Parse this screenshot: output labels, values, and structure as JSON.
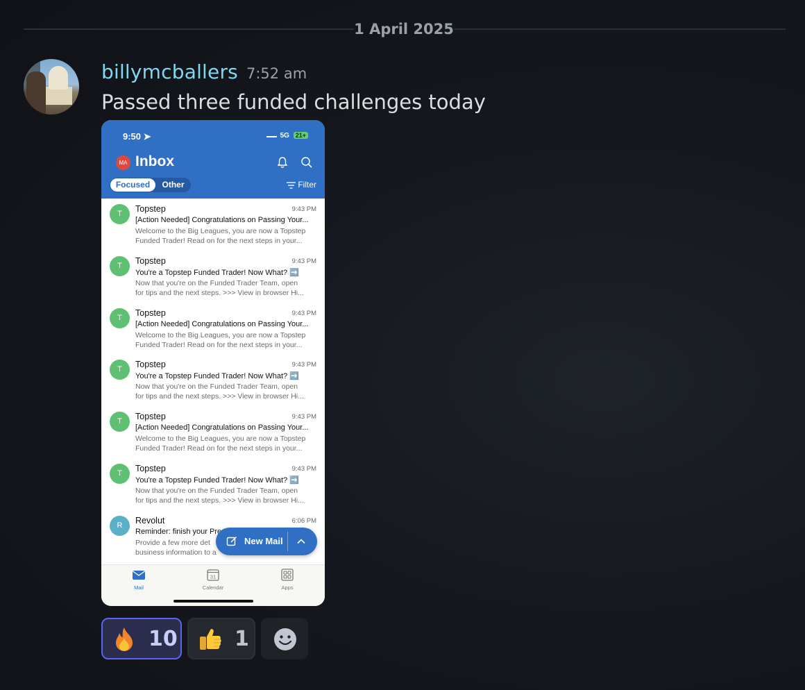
{
  "date_divider": "1 April 2025",
  "message": {
    "username": "billymcballers",
    "timestamp": "7:52 am",
    "text": "Passed three funded challenges today",
    "username_color": "#7fd8f0"
  },
  "screenshot": {
    "status_time": "9:50",
    "network": "5G",
    "battery": "21+",
    "account_initials": "MA",
    "title": "Inbox",
    "tabs": {
      "focused": "Focused",
      "other": "Other"
    },
    "filter_label": "Filter",
    "emails": [
      {
        "avatar": "T",
        "avatar_color": "#5fbf73",
        "sender": "Topstep",
        "time": "9:43 PM",
        "subject": "[Action Needed] Congratulations on Passing Your...",
        "preview1": "Welcome to the Big Leagues, you are now a Topstep",
        "preview2": "Funded Trader! Read on for the next steps in your..."
      },
      {
        "avatar": "T",
        "avatar_color": "#5fbf73",
        "sender": "Topstep",
        "time": "9:43 PM",
        "subject": "You're a Topstep Funded Trader! Now What? ➡️",
        "preview1": "Now that you're on the Funded Trader Team, open",
        "preview2": "for tips and the next steps. >>> View in browser Hi..."
      },
      {
        "avatar": "T",
        "avatar_color": "#5fbf73",
        "sender": "Topstep",
        "time": "9:43 PM",
        "subject": "[Action Needed] Congratulations on Passing Your...",
        "preview1": "Welcome to the Big Leagues, you are now a Topstep",
        "preview2": "Funded Trader! Read on for the next steps in your..."
      },
      {
        "avatar": "T",
        "avatar_color": "#5fbf73",
        "sender": "Topstep",
        "time": "9:43 PM",
        "subject": "You're a Topstep Funded Trader! Now What? ➡️",
        "preview1": "Now that you're on the Funded Trader Team, open",
        "preview2": "for tips and the next steps. >>> View in browser Hi..."
      },
      {
        "avatar": "T",
        "avatar_color": "#5fbf73",
        "sender": "Topstep",
        "time": "9:43 PM",
        "subject": "[Action Needed] Congratulations on Passing Your...",
        "preview1": "Welcome to the Big Leagues, you are now a Topstep",
        "preview2": "Funded Trader! Read on for the next steps in your..."
      },
      {
        "avatar": "T",
        "avatar_color": "#5fbf73",
        "sender": "Topstep",
        "time": "9:43 PM",
        "subject": "You're a Topstep Funded Trader! Now What? ➡️",
        "preview1": "Now that you're on the Funded Trader Team, open",
        "preview2": "for tips and the next steps. >>> View in browser Hi..."
      },
      {
        "avatar": "R",
        "avatar_color": "#5ab0c8",
        "sender": "Revolut",
        "time": "6:06 PM",
        "subject": "Reminder: finish your Pre",
        "preview1": "Provide a few more det",
        "preview2": "business information to a"
      }
    ],
    "fab_label": "New Mail",
    "bottom_tabs": [
      {
        "label": "Mail",
        "icon": "mail-icon"
      },
      {
        "label": "Calendar",
        "icon": "calendar-icon",
        "day": "31"
      },
      {
        "label": "Apps",
        "icon": "apps-grid-icon"
      }
    ]
  },
  "reactions": [
    {
      "emoji": "fire-emoji",
      "count": "10",
      "selected": true
    },
    {
      "emoji": "thumbs-up-emoji",
      "count": "1",
      "selected": false
    },
    {
      "emoji": "add-reaction-icon",
      "count": "",
      "selected": false
    }
  ]
}
